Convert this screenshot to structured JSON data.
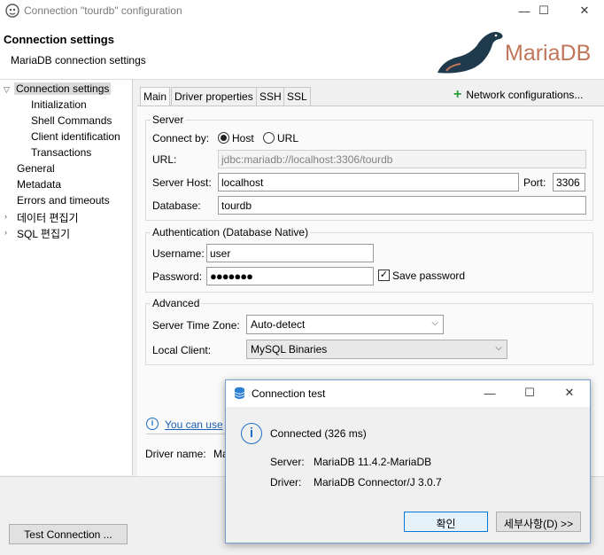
{
  "window": {
    "title": "Connection \"tourdb\" configuration",
    "minimize": "—",
    "maximize": "☐",
    "close": "✕"
  },
  "header": {
    "title": "Connection settings",
    "subtitle": "MariaDB connection settings",
    "logo_text": "MariaDB",
    "logo_color": "#c0765a"
  },
  "tree": {
    "items": [
      {
        "label": "Connection settings",
        "selected": true
      },
      {
        "label": "Initialization"
      },
      {
        "label": "Shell Commands"
      },
      {
        "label": "Client identification"
      },
      {
        "label": "Transactions"
      },
      {
        "label": "General"
      },
      {
        "label": "Metadata"
      },
      {
        "label": "Errors and timeouts"
      },
      {
        "label": "데이터 편집기"
      },
      {
        "label": "SQL 편집기"
      }
    ]
  },
  "tabs": [
    "Main",
    "Driver properties",
    "SSH",
    "SSL"
  ],
  "network_config": "Network configurations...",
  "server": {
    "group_label": "Server",
    "connect_by_label": "Connect by:",
    "host_option": "Host",
    "url_option": "URL",
    "url_label": "URL:",
    "url_value": "jdbc:mariadb://localhost:3306/tourdb",
    "host_label": "Server Host:",
    "host_value": "localhost",
    "port_label": "Port:",
    "port_value": "3306",
    "database_label": "Database:",
    "database_value": "tourdb"
  },
  "auth": {
    "group_label": "Authentication (Database Native)",
    "username_label": "Username:",
    "username_value": "user",
    "password_label": "Password:",
    "password_value": "●●●●●●●",
    "save_password_label": "Save password",
    "save_password_checked": "✓"
  },
  "advanced": {
    "group_label": "Advanced",
    "timezone_label": "Server Time Zone:",
    "timezone_value": "Auto-detect",
    "client_label": "Local Client:",
    "client_value": "MySQL Binaries"
  },
  "info_link": "You can use",
  "driver_name_label": "Driver name:",
  "driver_name_value": "Ma",
  "test_button": "Test Connection ...",
  "dialog": {
    "title": "Connection test",
    "status": "Connected (326 ms)",
    "server_label": "Server:",
    "server_value": "MariaDB 11.4.2-MariaDB",
    "driver_label": "Driver:",
    "driver_value": "MariaDB Connector/J 3.0.7",
    "ok_button": "확인",
    "details_button": "세부사항(D) >>"
  }
}
